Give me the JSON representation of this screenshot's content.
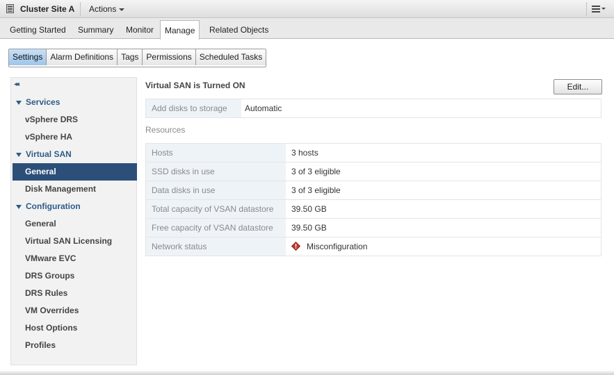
{
  "header": {
    "title": "Cluster Site A",
    "actions_label": "Actions"
  },
  "tabs": [
    {
      "label": "Getting Started"
    },
    {
      "label": "Summary"
    },
    {
      "label": "Monitor"
    },
    {
      "label": "Manage",
      "active": true
    },
    {
      "label": "Related Objects"
    }
  ],
  "subtabs": [
    {
      "label": "Settings",
      "active": true
    },
    {
      "label": "Alarm Definitions"
    },
    {
      "label": "Tags"
    },
    {
      "label": "Permissions"
    },
    {
      "label": "Scheduled Tasks"
    }
  ],
  "leftnav": {
    "collapse_glyph": "◂◂",
    "items": [
      {
        "label": "Services",
        "type": "group"
      },
      {
        "label": "vSphere DRS"
      },
      {
        "label": "vSphere HA"
      },
      {
        "label": "Virtual SAN",
        "type": "group"
      },
      {
        "label": "General",
        "selected": true
      },
      {
        "label": "Disk Management"
      },
      {
        "label": "Configuration",
        "type": "group"
      },
      {
        "label": "General"
      },
      {
        "label": "Virtual SAN Licensing"
      },
      {
        "label": "VMware EVC"
      },
      {
        "label": "DRS Groups"
      },
      {
        "label": "DRS Rules"
      },
      {
        "label": "VM Overrides"
      },
      {
        "label": "Host Options"
      },
      {
        "label": "Profiles"
      }
    ]
  },
  "main": {
    "status_heading": "Virtual SAN is Turned ON",
    "edit_label": "Edit...",
    "add_disks": {
      "label": "Add disks to storage",
      "value": "Automatic"
    },
    "resources_heading": "Resources",
    "resources": [
      {
        "label": "Hosts",
        "value": "3 hosts"
      },
      {
        "label": "SSD disks in use",
        "value": "3 of 3 eligible"
      },
      {
        "label": "Data disks in use",
        "value": "3 of 3 eligible"
      },
      {
        "label": "Total capacity of VSAN datastore",
        "value": "39.50 GB"
      },
      {
        "label": "Free capacity of VSAN datastore",
        "value": "39.50 GB"
      },
      {
        "label": "Network status",
        "value": "Misconfiguration",
        "status": "warning"
      }
    ]
  },
  "colors": {
    "accent": "#2c4f79",
    "group_text": "#2d5c86",
    "label_bg": "#eef3f8",
    "warning": "#c0392b"
  }
}
